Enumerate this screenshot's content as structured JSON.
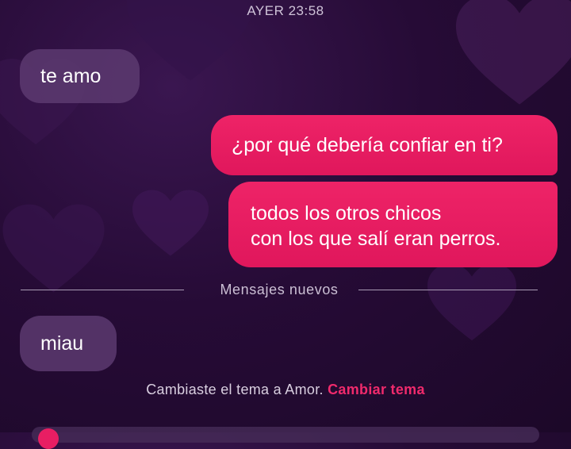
{
  "timestamp": "AYER 23:58",
  "messages": [
    {
      "side": "received",
      "text": "te amo"
    },
    {
      "side": "sent",
      "text": "¿por qué debería confiar en ti?"
    },
    {
      "side": "sent",
      "lines": [
        "todos los otros chicos",
        "con los que salí eran perros."
      ]
    },
    {
      "side": "received",
      "text": "miau"
    }
  ],
  "divider_label": "Mensajes nuevos",
  "theme_notice": {
    "text": "Cambiaste el tema a Amor.",
    "link_label": "Cambiar tema"
  },
  "colors": {
    "background": "#260b36",
    "sent_bubble": "#e81e63",
    "received_bubble": "#5c3a70",
    "link": "#f02a6c"
  },
  "icons": [
    "heart-icon"
  ]
}
